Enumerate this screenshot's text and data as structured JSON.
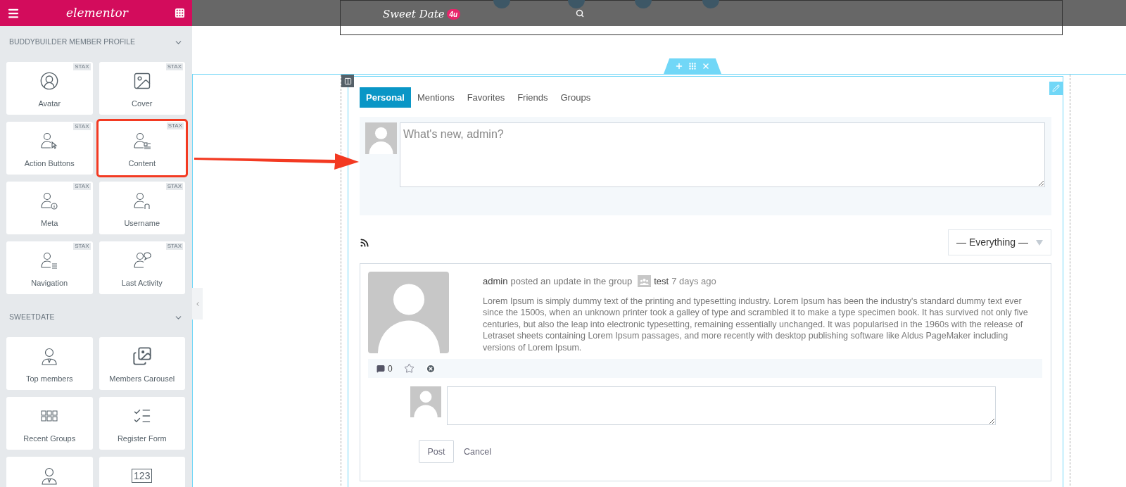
{
  "editor_panel": {
    "logo": "elementor",
    "sections": [
      {
        "title": "BUDDYBUILDER MEMBER PROFILE",
        "expanded": true,
        "widgets": [
          {
            "label": "Avatar",
            "badge": "STAX",
            "kind": "avatar",
            "highlighted": false
          },
          {
            "label": "Cover",
            "badge": "STAX",
            "kind": "cover",
            "highlighted": false
          },
          {
            "label": "Action Buttons",
            "badge": "STAX",
            "kind": "userpointer",
            "highlighted": false
          },
          {
            "label": "Content",
            "badge": "STAX",
            "kind": "userdocument",
            "highlighted": true
          },
          {
            "label": "Meta",
            "badge": "STAX",
            "kind": "userinfo",
            "highlighted": false
          },
          {
            "label": "Username",
            "badge": "STAX",
            "kind": "userletter",
            "highlighted": false
          },
          {
            "label": "Navigation",
            "badge": "STAX",
            "kind": "userlines",
            "highlighted": false
          },
          {
            "label": "Last Activity",
            "badge": "STAX",
            "kind": "userbubble",
            "highlighted": false
          }
        ]
      },
      {
        "title": "SWEETDATE",
        "expanded": true,
        "widgets": [
          {
            "label": "Top members",
            "kind": "person",
            "highlighted": false
          },
          {
            "label": "Members Carousel",
            "kind": "photos",
            "highlighted": false
          },
          {
            "label": "Recent Groups",
            "kind": "grid",
            "highlighted": false
          },
          {
            "label": "Register Form",
            "kind": "checklist",
            "highlighted": false
          },
          {
            "kind": "person",
            "highlighted": false
          },
          {
            "kind": "number",
            "glyph": "123",
            "highlighted": false
          }
        ]
      }
    ]
  },
  "site_header": {
    "logo": "Sweet Date",
    "logo_badge": "4u"
  },
  "profile": {
    "tabs": [
      {
        "label": "Personal",
        "selected": true
      },
      {
        "label": "Mentions",
        "selected": false
      },
      {
        "label": "Favorites",
        "selected": false
      },
      {
        "label": "Friends",
        "selected": false
      },
      {
        "label": "Groups",
        "selected": false
      }
    ],
    "post_form": {
      "placeholder": "What's new, admin?"
    },
    "filter": {
      "value": "— Everything —"
    },
    "activity": [
      {
        "author": "admin",
        "action": "posted an update in the group",
        "group": "test",
        "time": "7 days ago",
        "body": "Lorem Ipsum is simply dummy text of the printing and typesetting industry. Lorem Ipsum has been the industry's standard dummy text ever since the 1500s, when an unknown printer took a galley of type and scrambled it to make a type specimen book. It has survived not only five centuries, but also the leap into electronic typesetting, remaining essentially unchanged. It was popularised in the 1960s with the release of Letraset sheets containing Lorem Ipsum passages, and more recently with desktop publishing software like Aldus PageMaker including versions of Lorem Ipsum.",
        "comment_count": "0",
        "comment_form": {
          "buttons": [
            "Post",
            "Cancel"
          ]
        }
      }
    ]
  }
}
